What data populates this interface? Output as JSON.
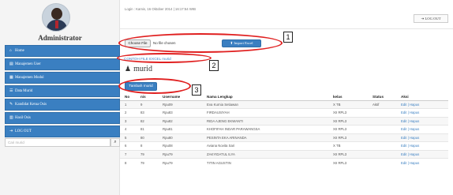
{
  "sidebar": {
    "admin_title": "Administrator",
    "menu": [
      {
        "icon": "home-icon",
        "glyph": "⌂",
        "label": "Home"
      },
      {
        "icon": "users-icon",
        "glyph": "▤",
        "label": "Manajemen User"
      },
      {
        "icon": "grid-icon",
        "glyph": "▦",
        "label": "Manajemen Modul"
      },
      {
        "icon": "list-icon",
        "glyph": "☰",
        "label": "Data Murid"
      },
      {
        "icon": "edit-icon",
        "glyph": "✎",
        "label": "Kandidat Ketua Osis"
      },
      {
        "icon": "chart-icon",
        "glyph": "▥",
        "label": "Hasil Osis"
      },
      {
        "icon": "logout-icon",
        "glyph": "⇥",
        "label": "LOG OUT"
      }
    ],
    "search_placeholder": "Cari murid",
    "search_glyph": "⌕"
  },
  "header": {
    "login_info": "Login : Kamis, 16 Oktober 2014 | 16:17:54 WIB",
    "logout_label": "⇥ LOG OUT"
  },
  "upload": {
    "choose_file_label": "Choose File",
    "no_file_text": "No file chosen",
    "import_label": "⬆ Import Excel"
  },
  "contoh_link": "CONTOH FILE EXCEL murid",
  "section": {
    "icon_glyph": "♟",
    "title": "murid"
  },
  "tambah_label": "Tambah murid",
  "annotations": [
    "1",
    "2",
    "3"
  ],
  "table": {
    "headers": [
      "No",
      "nis",
      "Username",
      "Nama Lengkap",
      "kelas",
      "Status",
      "Aksi"
    ],
    "rows": [
      {
        "no": "1",
        "nis": "9",
        "username": "Rpu09",
        "nama": "Eva Kurnia Setiawan",
        "kelas": "X TB",
        "status": "Aktif",
        "aksi": "Edit | Hapus"
      },
      {
        "no": "2",
        "nis": "83",
        "username": "Rpu83",
        "nama": "FIRDAUSIYAH",
        "kelas": "XII RPL3",
        "status": "",
        "aksi": "Edit | Hapus"
      },
      {
        "no": "3",
        "nis": "82",
        "username": "Rpu82",
        "nama": "RIDA AJENG EKWANTI",
        "kelas": "XII RPL3",
        "status": "",
        "aksi": "Edit | Hapus"
      },
      {
        "no": "4",
        "nis": "81",
        "username": "Rpu81",
        "nama": "KHOFIFAH INDAR PARAWANGSA",
        "kelas": "XII RPL3",
        "status": "",
        "aksi": "Edit | Hapus"
      },
      {
        "no": "5",
        "nis": "80",
        "username": "Rpu80",
        "nama": "PESINTA EKA ARINANDA",
        "kelas": "XII RPL3",
        "status": "",
        "aksi": "Edit | Hapus"
      },
      {
        "no": "6",
        "nis": "8",
        "username": "Rpu08",
        "nama": "Aviana Novita Sari",
        "kelas": "X TB",
        "status": "",
        "aksi": "Edit | Hapus"
      },
      {
        "no": "7",
        "nis": "79",
        "username": "Rpu79",
        "nama": "ZAKYIDATUL ILYA",
        "kelas": "XII RPL3",
        "status": "",
        "aksi": "Edit | Hapus"
      },
      {
        "no": "8",
        "nis": "79",
        "username": "Rpu79",
        "nama": "TITIN AGUSTIN",
        "kelas": "XII RPL3",
        "status": "",
        "aksi": "Edit | Hapus"
      }
    ]
  }
}
